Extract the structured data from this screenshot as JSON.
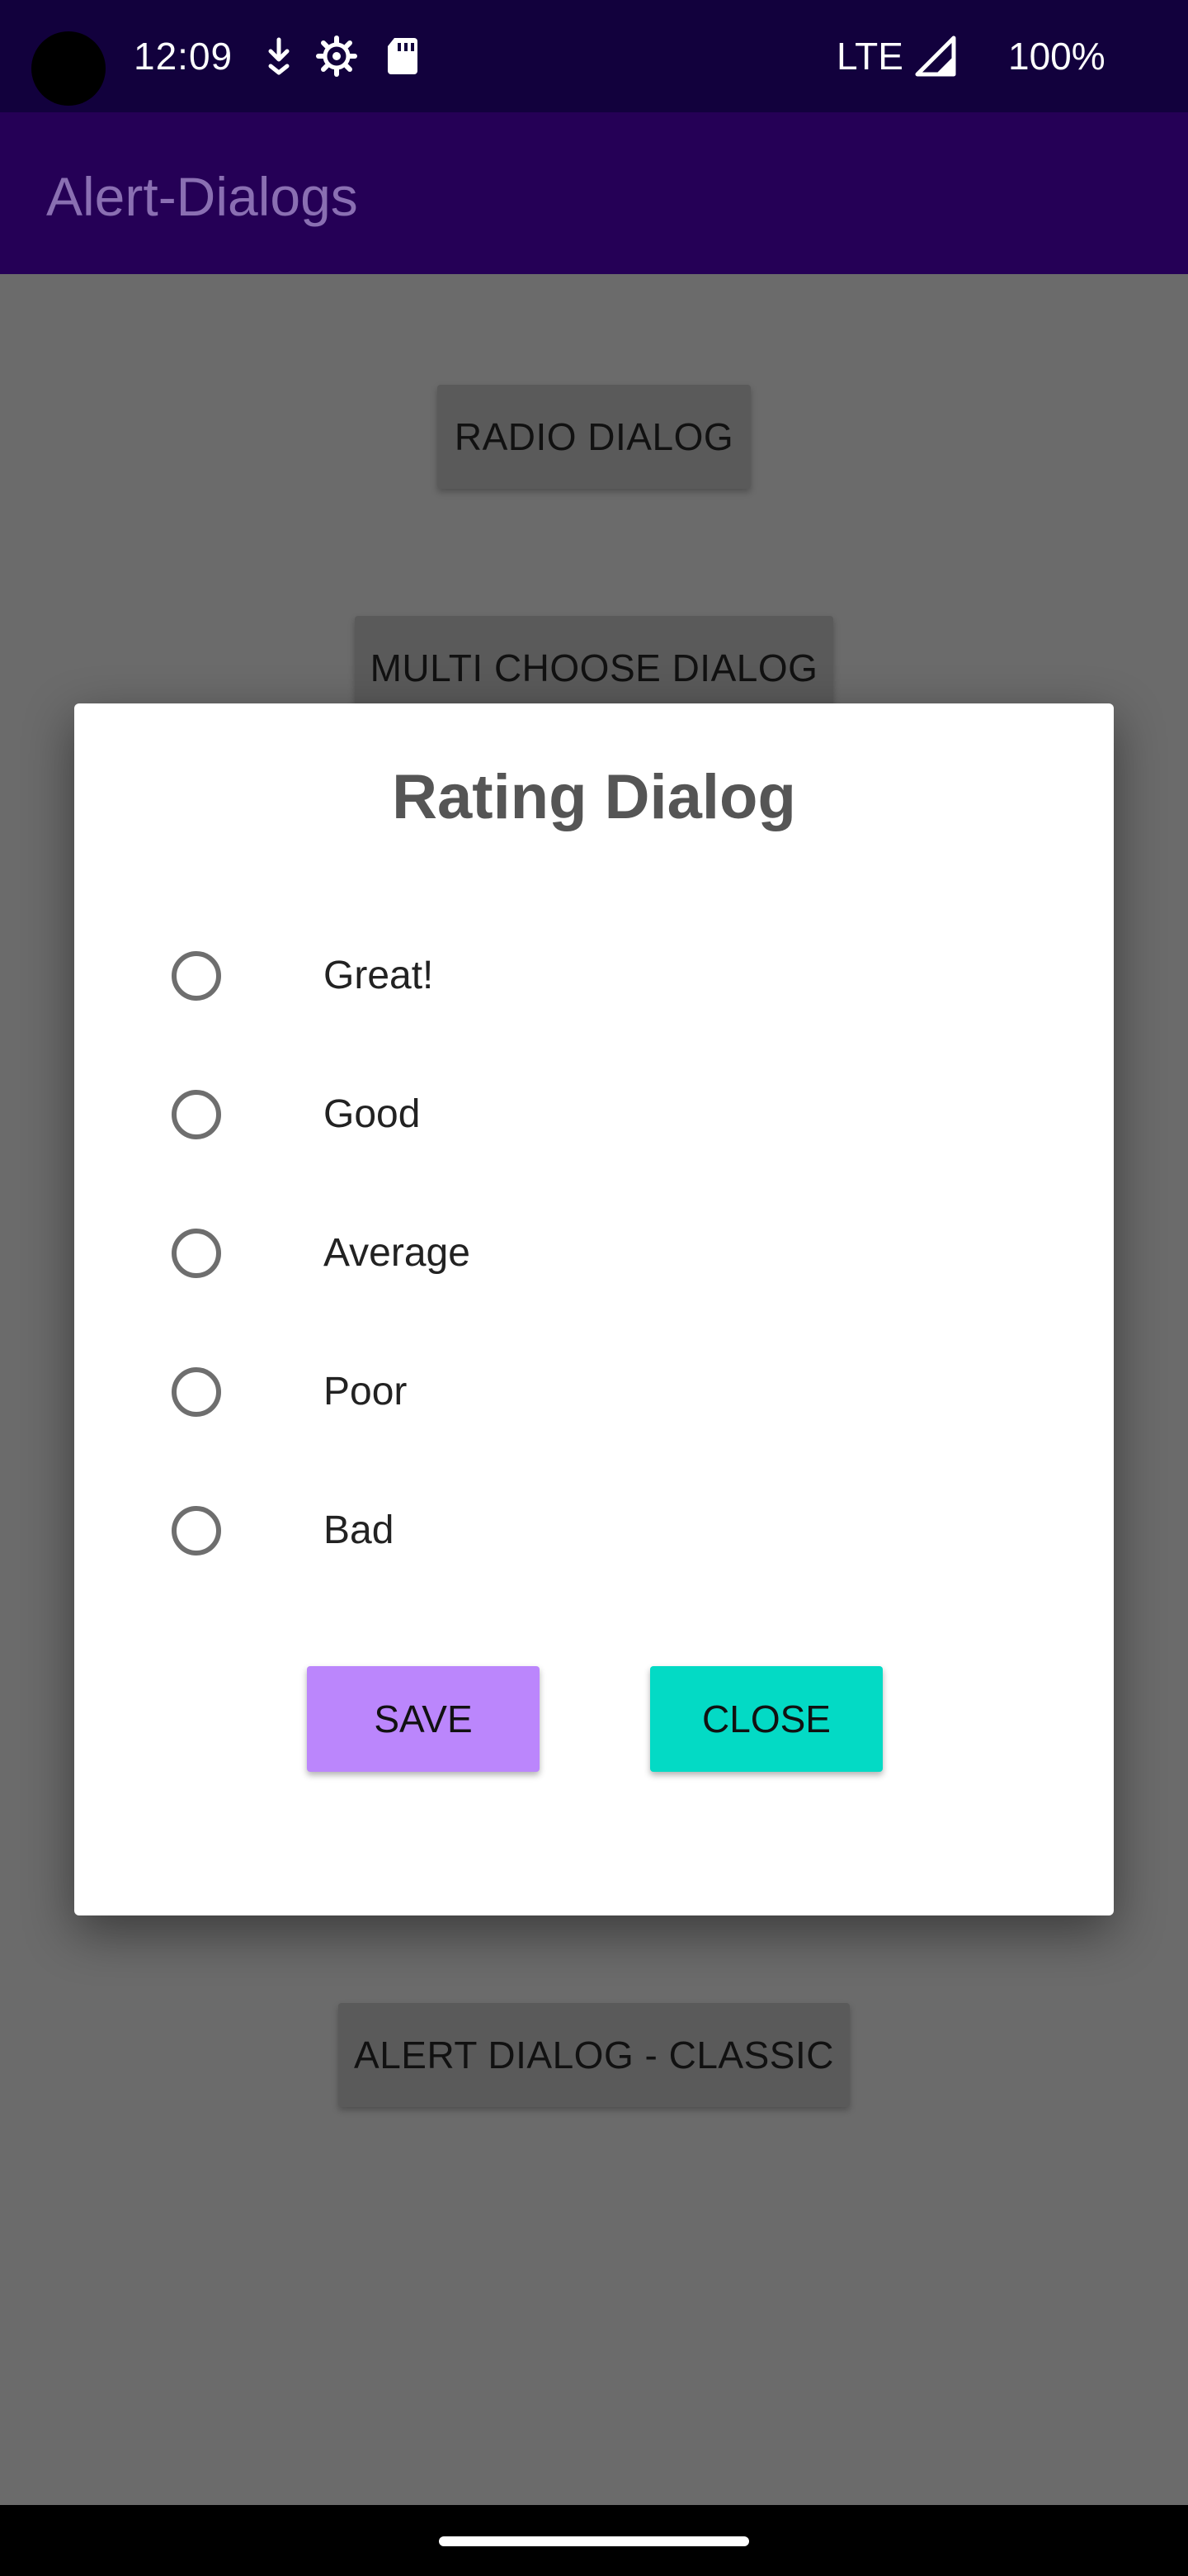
{
  "status_bar": {
    "time": "12:09",
    "network": "LTE",
    "battery": "100%",
    "icons": [
      "camera-hole",
      "download-arrow-icon",
      "settings-gear-icon",
      "sd-card-icon",
      "signal-icon"
    ]
  },
  "app_bar": {
    "title": "Alert-Dialogs"
  },
  "background_buttons": {
    "radio_dialog": "RADIO DIALOG",
    "multi_choose_dialog": "MULTI CHOOSE DIALOG",
    "alert_dialog_classic": "ALERT DIALOG - CLASSIC"
  },
  "dialog": {
    "title": "Rating Dialog",
    "options": [
      {
        "label": "Great!",
        "checked": false
      },
      {
        "label": "Good",
        "checked": false
      },
      {
        "label": "Average",
        "checked": false
      },
      {
        "label": "Poor",
        "checked": false
      },
      {
        "label": "Bad",
        "checked": false
      }
    ],
    "save_label": "SAVE",
    "close_label": "CLOSE"
  },
  "colors": {
    "status_bar": "#12013d",
    "app_bar": "#250056",
    "scrim": "#6b6b6b",
    "save_button": "#bb86fc",
    "close_button": "#03dac5"
  }
}
